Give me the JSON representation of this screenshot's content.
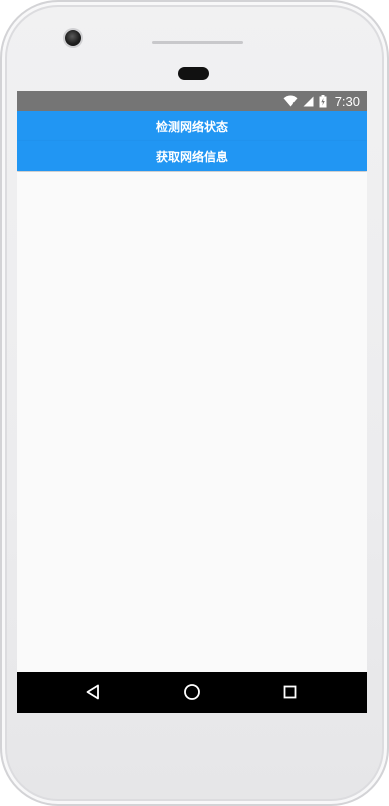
{
  "status_bar": {
    "time": "7:30",
    "icons": [
      "wifi-icon",
      "signal-icon",
      "battery-icon"
    ]
  },
  "buttons": {
    "check_network_state": "检测网络状态",
    "get_network_info": "获取网络信息"
  },
  "nav_bar": {
    "icons": [
      "back-icon",
      "home-icon",
      "recents-icon"
    ]
  },
  "colors": {
    "status_bar": "#757575",
    "accent": "#2196f3",
    "background": "#fafafa",
    "nav_bar": "#000000"
  }
}
